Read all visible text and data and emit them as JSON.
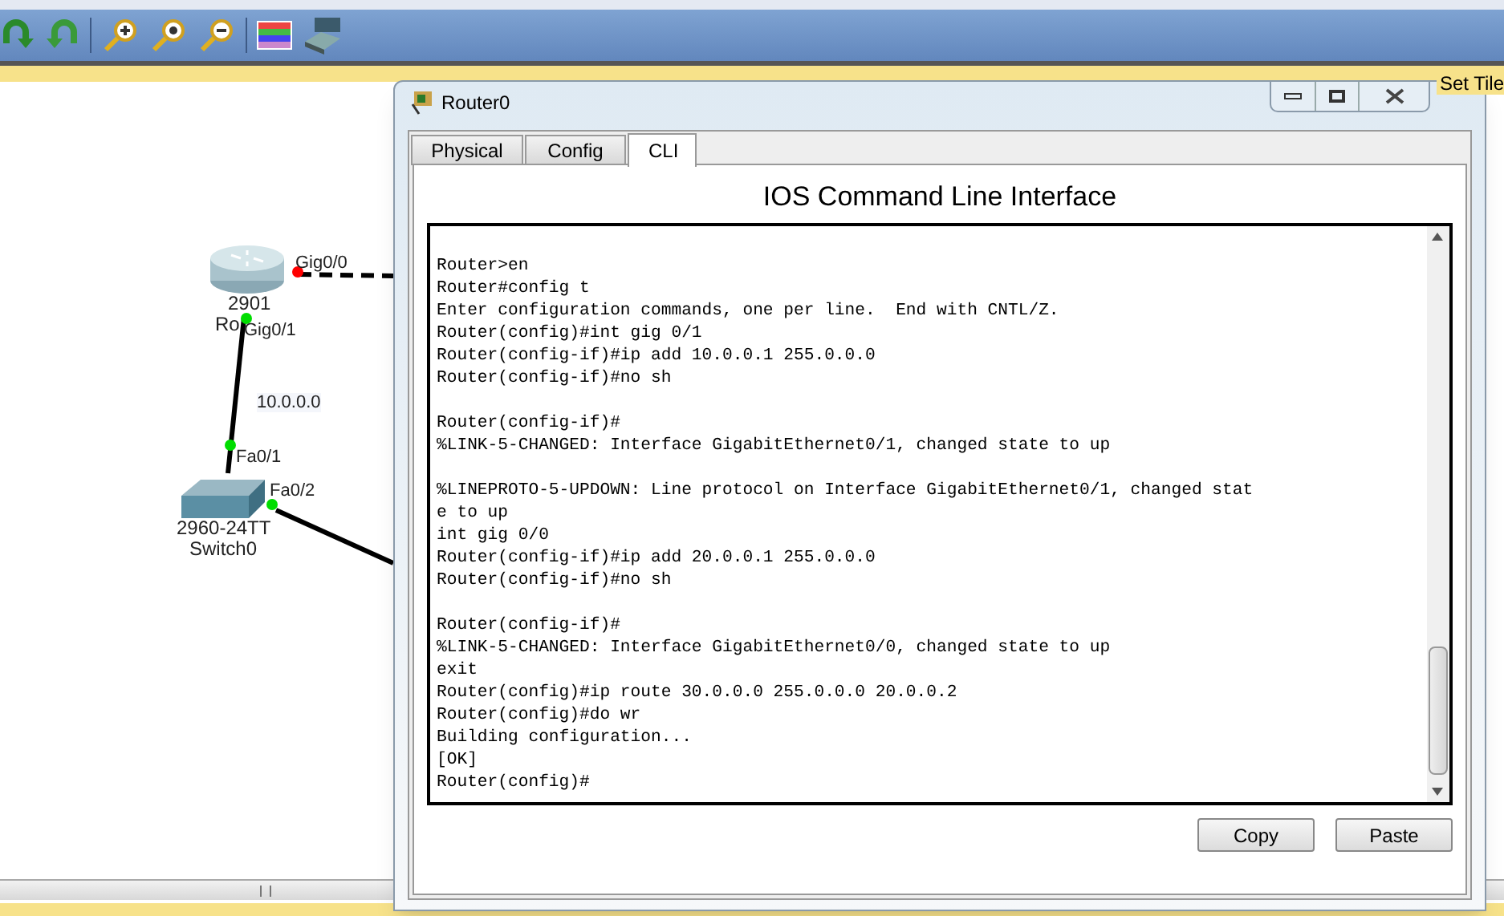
{
  "toolbar": {
    "buttons": [
      {
        "kind": "undo"
      },
      {
        "kind": "redo"
      },
      {
        "kind": "zoom-in"
      },
      {
        "kind": "zoom-reset"
      },
      {
        "kind": "zoom-out"
      },
      {
        "kind": "palette"
      },
      {
        "kind": "device"
      }
    ]
  },
  "workspace_bar": {
    "items": [
      "Set Tile"
    ]
  },
  "canvas": {
    "devices": [
      {
        "kind": "router",
        "model": "2901",
        "name": "Ro"
      },
      {
        "kind": "switch",
        "model": "2960-24TT",
        "name": "Switch0"
      }
    ],
    "ports": [
      {
        "label": "Gig0/0",
        "color": "#ff0000"
      },
      {
        "label": "Gig0/1",
        "color": "#00dd00"
      },
      {
        "label": "Fa0/1",
        "color": "#00dd00"
      },
      {
        "label": "Fa0/2",
        "color": "#00dd00"
      }
    ],
    "network_label": "10.0.0.0"
  },
  "window": {
    "title": "Router0",
    "tabs": [
      {
        "label": "Physical",
        "selected": false
      },
      {
        "label": "Config",
        "selected": false
      },
      {
        "label": "CLI",
        "selected": true
      }
    ],
    "heading": "IOS Command Line Interface",
    "console": "\nRouter>en\nRouter#config t\nEnter configuration commands, one per line.  End with CNTL/Z.\nRouter(config)#int gig 0/1\nRouter(config-if)#ip add 10.0.0.1 255.0.0.0\nRouter(config-if)#no sh\n\nRouter(config-if)#\n%LINK-5-CHANGED: Interface GigabitEthernet0/1, changed state to up\n\n%LINEPROTO-5-UPDOWN: Line protocol on Interface GigabitEthernet0/1, changed stat\ne to up\nint gig 0/0\nRouter(config-if)#ip add 20.0.0.1 255.0.0.0\nRouter(config-if)#no sh\n\nRouter(config-if)#\n%LINK-5-CHANGED: Interface GigabitEthernet0/0, changed state to up\nexit\nRouter(config)#ip route 30.0.0.0 255.0.0.0 20.0.0.2\nRouter(config)#do wr\nBuilding configuration...\n[OK]\nRouter(config)#",
    "buttons": [
      "Copy",
      "Paste"
    ]
  }
}
